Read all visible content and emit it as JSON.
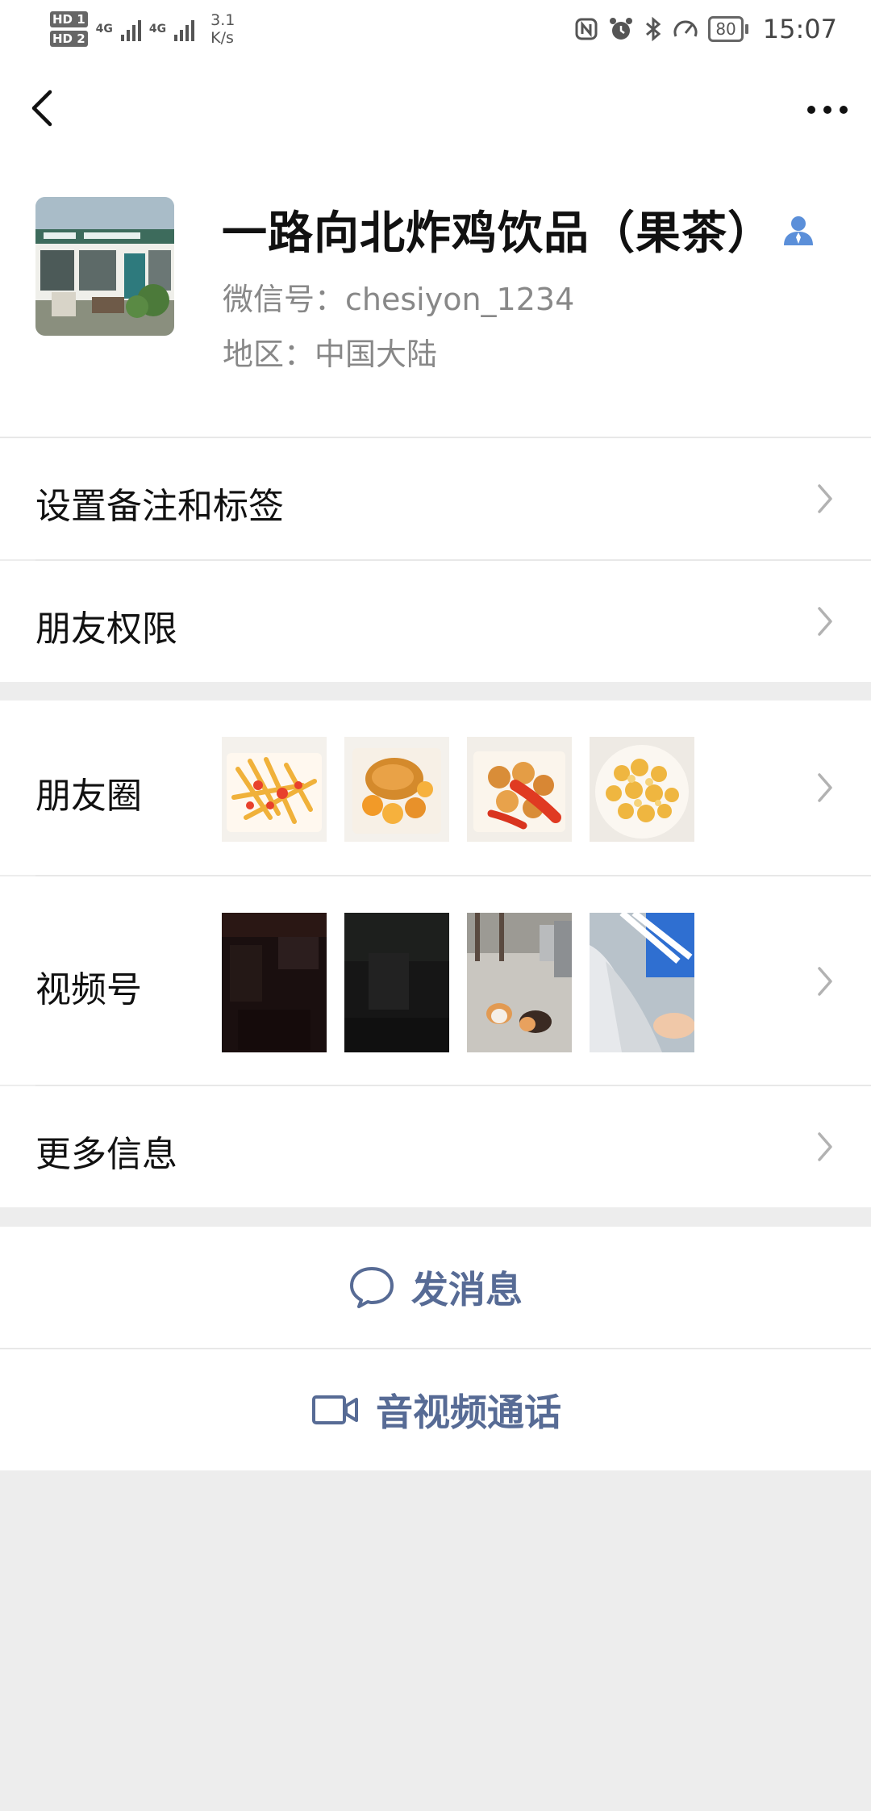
{
  "status_bar": {
    "sim1": "HD 1",
    "sim2": "HD 2",
    "net1": "4G",
    "net2": "4G",
    "speed_value": "3.1",
    "speed_unit": "K/s",
    "battery": "80",
    "time": "15:07",
    "icons": [
      "nfc-icon",
      "alarm-icon",
      "bluetooth-icon",
      "speedometer-icon"
    ]
  },
  "nav": {
    "back_icon": "chevron-left-icon",
    "more_icon": "ellipsis-icon"
  },
  "profile": {
    "name": "一路向北炸鸡饮品（果茶）",
    "wechat_id": "微信号：chesiyon_1234",
    "region": "地区：中国大陆",
    "badge_icon": "person-icon"
  },
  "menu": {
    "remark_tags": "设置备注和标签",
    "friend_permissions": "朋友权限",
    "moments": "朋友圈",
    "channels": "视频号",
    "more_info": "更多信息"
  },
  "actions": {
    "send_message": "发消息",
    "video_call": "音视频通话"
  },
  "colors": {
    "link_blue": "#576b95",
    "background": "#ededed",
    "badge_blue": "#5b8fd9"
  }
}
